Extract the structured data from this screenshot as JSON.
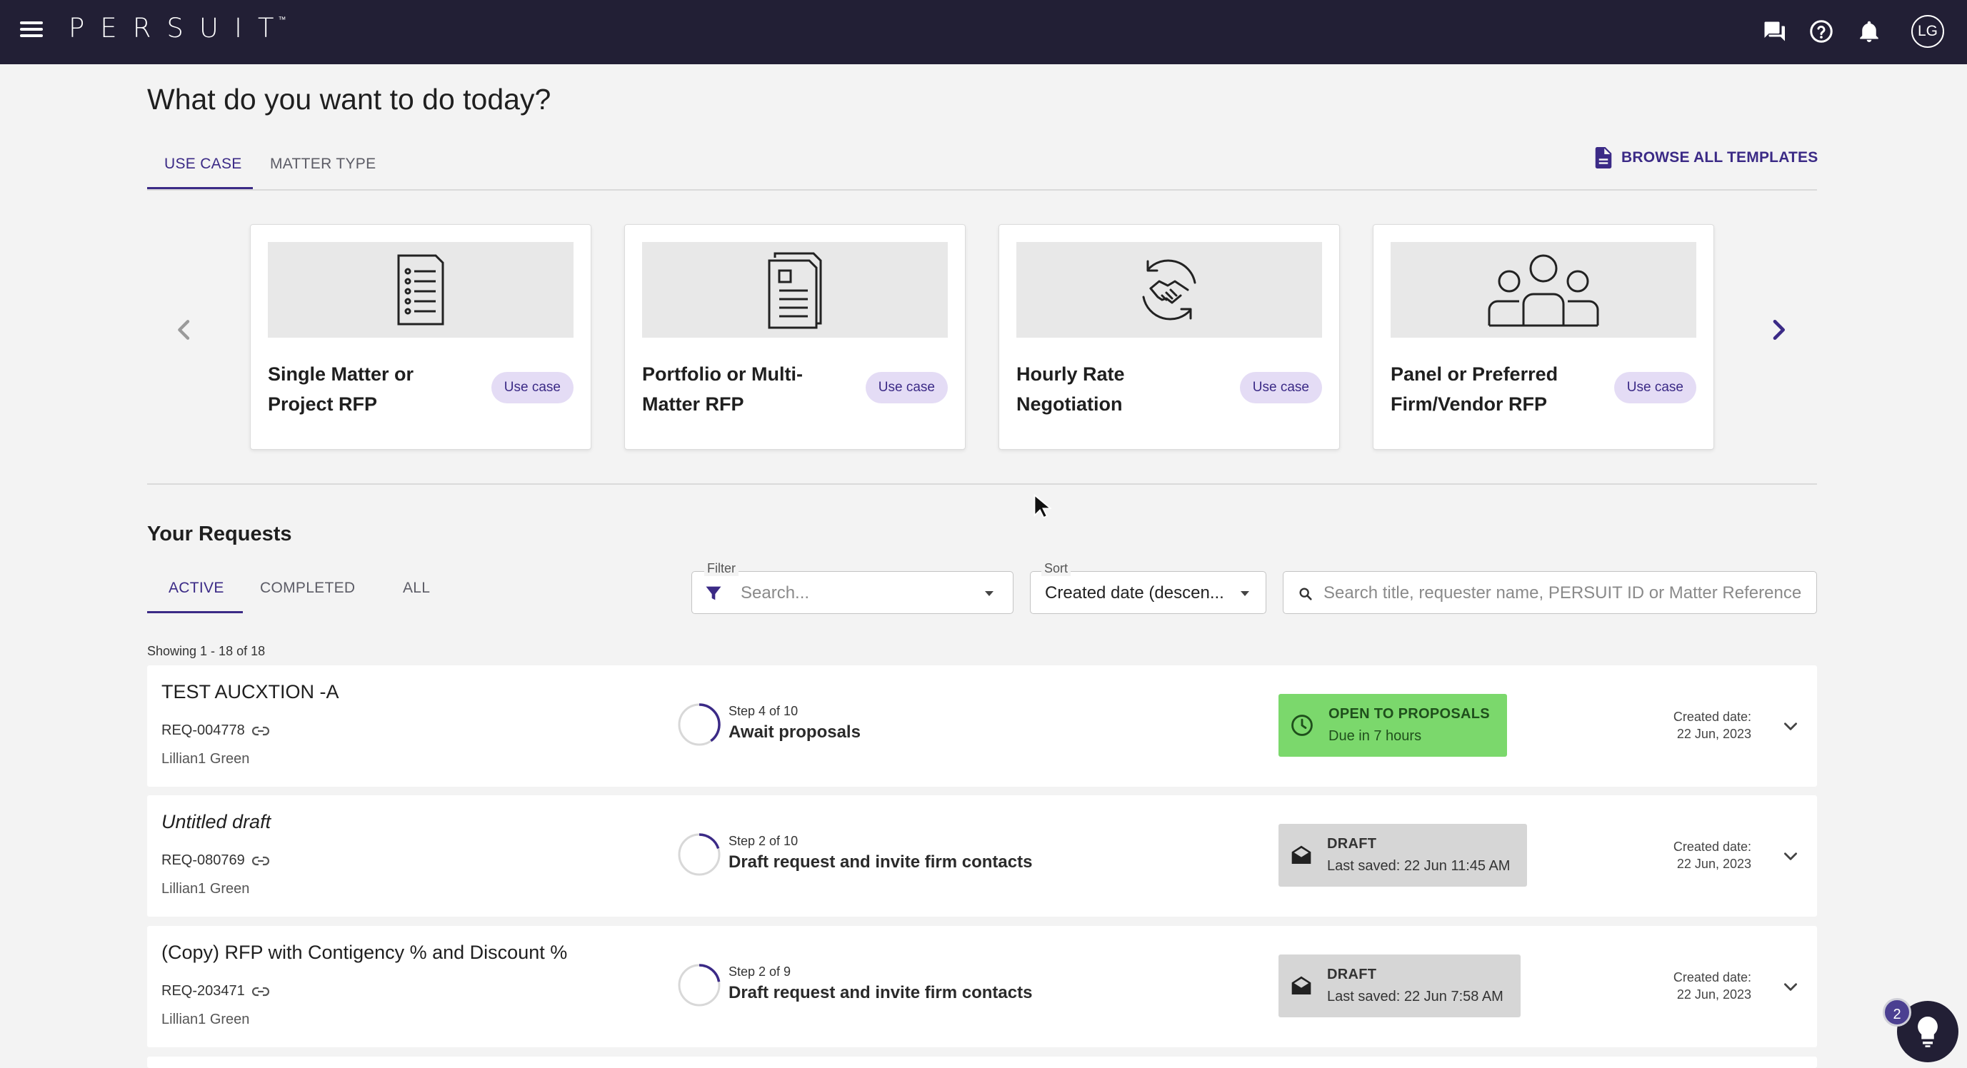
{
  "app": {
    "brand": "PERSUIT",
    "brand_mark": "™",
    "user_initials": "LG"
  },
  "header_icons": [
    "menu-icon",
    "chat-icon",
    "help-icon",
    "bell-icon",
    "avatar"
  ],
  "page": {
    "title": "What do you want to do today?",
    "tabs": [
      {
        "label": "USE CASE",
        "active": true
      },
      {
        "label": "MATTER TYPE",
        "active": false
      }
    ],
    "browse_label": "BROWSE ALL TEMPLATES"
  },
  "templates": [
    {
      "label": "Single Matter or Project RFP",
      "chip": "Use case",
      "icon": "checklist-document-icon"
    },
    {
      "label": "Portfolio or Multi-Matter RFP",
      "chip": "Use case",
      "icon": "stacked-documents-icon"
    },
    {
      "label": "Hourly Rate Negotiation",
      "chip": "Use case",
      "icon": "handshake-icon"
    },
    {
      "label": "Panel or Preferred Firm/Vendor RFP",
      "chip": "Use case",
      "icon": "group-icon"
    }
  ],
  "requests": {
    "title": "Your Requests",
    "tabs": [
      {
        "label": "ACTIVE",
        "active": true
      },
      {
        "label": "COMPLETED",
        "active": false
      },
      {
        "label": "ALL",
        "active": false
      }
    ],
    "filter": {
      "label": "Filter",
      "placeholder": "Search..."
    },
    "sort": {
      "label": "Sort",
      "value": "Created date (descen..."
    },
    "search": {
      "placeholder": "Search title, requester name, PERSUIT ID or Matter Reference"
    },
    "showing": "Showing 1 - 18 of 18",
    "items": [
      {
        "title": "TEST AUCXTION -A",
        "italic": false,
        "id": "REQ-004778",
        "person": "Lillian1 Green",
        "step_of": "Step 4 of 10",
        "step_name": "Await proposals",
        "progress": 0.4,
        "status": "OPEN TO PROPOSALS",
        "status_sub": "Due in 7 hours",
        "status_kind": "open",
        "created_label": "Created date:",
        "created": "22 Jun, 2023"
      },
      {
        "title": "Untitled draft",
        "italic": true,
        "id": "REQ-080769",
        "person": "Lillian1 Green",
        "step_of": "Step 2 of 10",
        "step_name": "Draft request and invite firm contacts",
        "progress": 0.2,
        "status": "DRAFT",
        "status_sub": "Last saved: 22 Jun 11:45 AM",
        "status_kind": "draft",
        "created_label": "Created date:",
        "created": "22 Jun, 2023"
      },
      {
        "title": "(Copy) RFP with Contigency % and Discount %",
        "italic": false,
        "id": "REQ-203471",
        "person": "Lillian1 Green",
        "step_of": "Step 2 of 9",
        "step_name": "Draft request and invite firm contacts",
        "progress": 0.222,
        "status": "DRAFT",
        "status_sub": "Last saved: 22 Jun 7:58 AM",
        "status_kind": "draft",
        "created_label": "Created date:",
        "created": "22 Jun, 2023"
      }
    ]
  },
  "help": {
    "badge": "2"
  },
  "colors": {
    "topbar": "#221f35",
    "accent": "#3b2a86",
    "chip_bg": "#e4dcf5",
    "open_status": "#7bd86c",
    "draft_status": "#d6d6d6"
  }
}
